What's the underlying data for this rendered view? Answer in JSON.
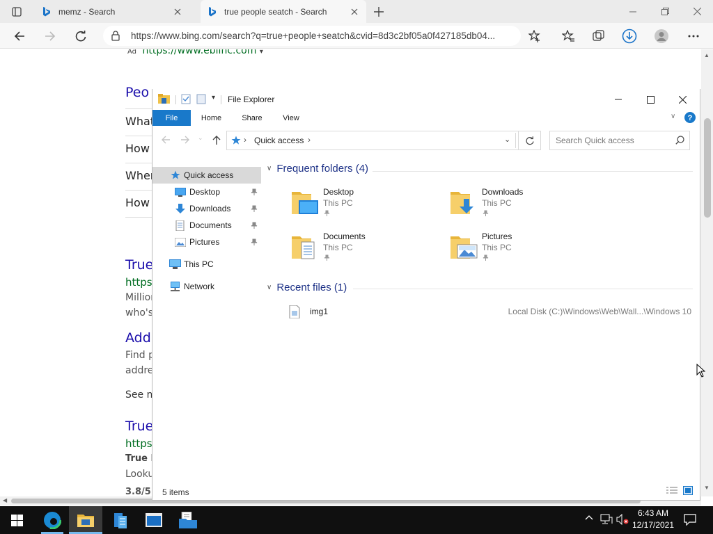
{
  "browser": {
    "tabs": [
      {
        "label": "memz - Search"
      },
      {
        "label": "true people seatch - Search"
      }
    ],
    "url": "https://www.bing.com/search?q=true+people+seatch&cvid=8d3c2bf05a0f427185db04..."
  },
  "page": {
    "ad_label": "Ad",
    "ad_url": "https://www.ebiinc.com",
    "people_also_ask": "Peo",
    "questions": [
      "What",
      "How",
      "Wher",
      "How"
    ],
    "results": [
      {
        "title": "True",
        "url": "https",
        "snippet": [
          "Millior",
          "who's"
        ]
      },
      {
        "title": "Add",
        "snippet": [
          "Find p",
          "addre"
        ],
        "more": "See m"
      },
      {
        "title": "True",
        "url": "https",
        "bold": "True F",
        "snippet": [
          "Looku"
        ],
        "rating": "3.8/5"
      }
    ]
  },
  "explorer": {
    "title": "File Explorer",
    "ribbon_tabs": [
      "File",
      "Home",
      "Share",
      "View"
    ],
    "address": "Quick access",
    "search_placeholder": "Search Quick access",
    "nav": {
      "quick_access": "Quick access",
      "pinned": [
        "Desktop",
        "Downloads",
        "Documents",
        "Pictures"
      ],
      "this_pc": "This PC",
      "network": "Network"
    },
    "frequent_header": "Frequent folders (4)",
    "frequent": [
      {
        "name": "Desktop",
        "sub": "This PC"
      },
      {
        "name": "Downloads",
        "sub": "This PC"
      },
      {
        "name": "Documents",
        "sub": "This PC"
      },
      {
        "name": "Pictures",
        "sub": "This PC"
      }
    ],
    "recent_header": "Recent files (1)",
    "recent": [
      {
        "name": "img1",
        "path": "Local Disk (C:)\\Windows\\Web\\Wall...\\Windows 10"
      }
    ],
    "status": "5 items"
  },
  "taskbar": {
    "time": "6:43 AM",
    "date": "12/17/2021"
  },
  "colors": {
    "accent": "#1979ca",
    "link": "#1a0dab",
    "url_green": "#006d21"
  }
}
